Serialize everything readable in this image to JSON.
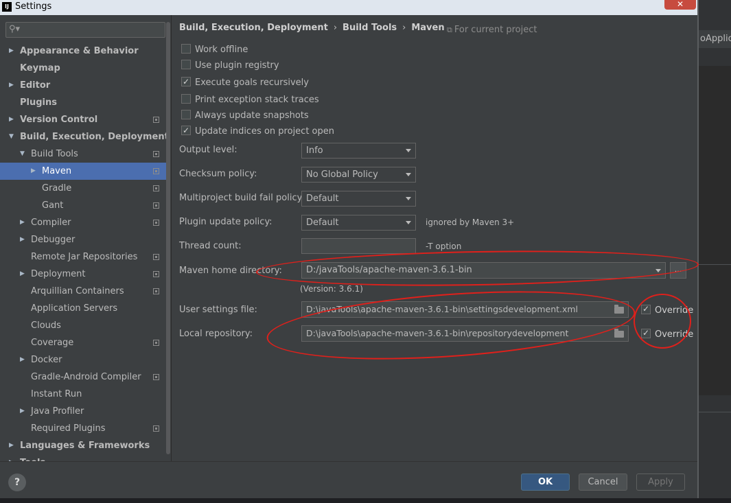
{
  "window": {
    "title": "Settings",
    "app_icon": "IJ",
    "close_glyph": "✕"
  },
  "background": {
    "tab_text": "oApplica"
  },
  "search": {
    "icon": "⚲▾"
  },
  "sidebar": {
    "items": [
      {
        "label": "Appearance & Behavior",
        "arrow": "▶",
        "bold": true,
        "proj": false
      },
      {
        "label": "Keymap",
        "arrow": "",
        "bold": true,
        "proj": false
      },
      {
        "label": "Editor",
        "arrow": "▶",
        "bold": true,
        "proj": false
      },
      {
        "label": "Plugins",
        "arrow": "",
        "bold": true,
        "proj": false
      },
      {
        "label": "Version Control",
        "arrow": "▶",
        "bold": true,
        "proj": true
      },
      {
        "label": "Build, Execution, Deployment",
        "arrow": "▼",
        "bold": true,
        "proj": false
      },
      {
        "label": "Build Tools",
        "arrow": "▼",
        "bold": false,
        "proj": true
      },
      {
        "label": "Maven",
        "arrow": "▶",
        "bold": false,
        "proj": true
      },
      {
        "label": "Gradle",
        "arrow": "",
        "bold": false,
        "proj": true
      },
      {
        "label": "Gant",
        "arrow": "",
        "bold": false,
        "proj": true
      },
      {
        "label": "Compiler",
        "arrow": "▶",
        "bold": false,
        "proj": true
      },
      {
        "label": "Debugger",
        "arrow": "▶",
        "bold": false,
        "proj": false
      },
      {
        "label": "Remote Jar Repositories",
        "arrow": "",
        "bold": false,
        "proj": true
      },
      {
        "label": "Deployment",
        "arrow": "▶",
        "bold": false,
        "proj": true
      },
      {
        "label": "Arquillian Containers",
        "arrow": "",
        "bold": false,
        "proj": true
      },
      {
        "label": "Application Servers",
        "arrow": "",
        "bold": false,
        "proj": false
      },
      {
        "label": "Clouds",
        "arrow": "",
        "bold": false,
        "proj": false
      },
      {
        "label": "Coverage",
        "arrow": "",
        "bold": false,
        "proj": true
      },
      {
        "label": "Docker",
        "arrow": "▶",
        "bold": false,
        "proj": false
      },
      {
        "label": "Gradle-Android Compiler",
        "arrow": "",
        "bold": false,
        "proj": true
      },
      {
        "label": "Instant Run",
        "arrow": "",
        "bold": false,
        "proj": false
      },
      {
        "label": "Java Profiler",
        "arrow": "▶",
        "bold": false,
        "proj": false
      },
      {
        "label": "Required Plugins",
        "arrow": "",
        "bold": false,
        "proj": true
      },
      {
        "label": "Languages & Frameworks",
        "arrow": "▶",
        "bold": true,
        "proj": false
      },
      {
        "label": "Tools",
        "arrow": "▶",
        "bold": true,
        "proj": false
      }
    ]
  },
  "breadcrumb": {
    "part1": "Build, Execution, Deployment",
    "part2": "Build Tools",
    "part3": "Maven",
    "sep": "›"
  },
  "for_current_project": "For current project",
  "options": {
    "work_offline": {
      "label": "Work offline",
      "checked": false
    },
    "use_plugin_registry": {
      "label": "Use plugin registry",
      "checked": false
    },
    "execute_goals_recursively": {
      "label": "Execute goals recursively",
      "checked": true
    },
    "print_exception_stack_traces": {
      "label": "Print exception stack traces",
      "checked": false
    },
    "always_update_snapshots": {
      "label": "Always update snapshots",
      "checked": false
    },
    "update_indices_on_open": {
      "label": "Update indices on project open",
      "checked": true
    }
  },
  "fields": {
    "output_level": {
      "label": "Output level:",
      "value": "Info"
    },
    "checksum_policy": {
      "label": "Checksum policy:",
      "value": "No Global Policy"
    },
    "multiproject_fail_policy": {
      "label": "Multiproject build fail policy:",
      "value": "Default"
    },
    "plugin_update_policy": {
      "label": "Plugin update policy:",
      "value": "Default",
      "hint": "ignored by Maven 3+"
    },
    "thread_count": {
      "label": "Thread count:",
      "value": "",
      "hint": "-T option"
    },
    "maven_home": {
      "label": "Maven home directory:",
      "value": "D:/javaTools/apache-maven-3.6.1-bin",
      "browse": "...",
      "version": "(Version: 3.6.1)"
    },
    "user_settings": {
      "label": "User settings file:",
      "value": "D:\\javaTools\\apache-maven-3.6.1-bin\\settingsdevelopment.xml",
      "override": "Override"
    },
    "local_repository": {
      "label": "Local repository:",
      "value": "D:\\javaTools\\apache-maven-3.6.1-bin\\repositorydevelopment",
      "override": "Override"
    }
  },
  "footer": {
    "help": "?",
    "ok": "OK",
    "cancel": "Cancel",
    "apply": "Apply"
  },
  "colors": {
    "accent": "#4b6eaf",
    "annotation": "#e0201b",
    "primary_button": "#365880"
  }
}
